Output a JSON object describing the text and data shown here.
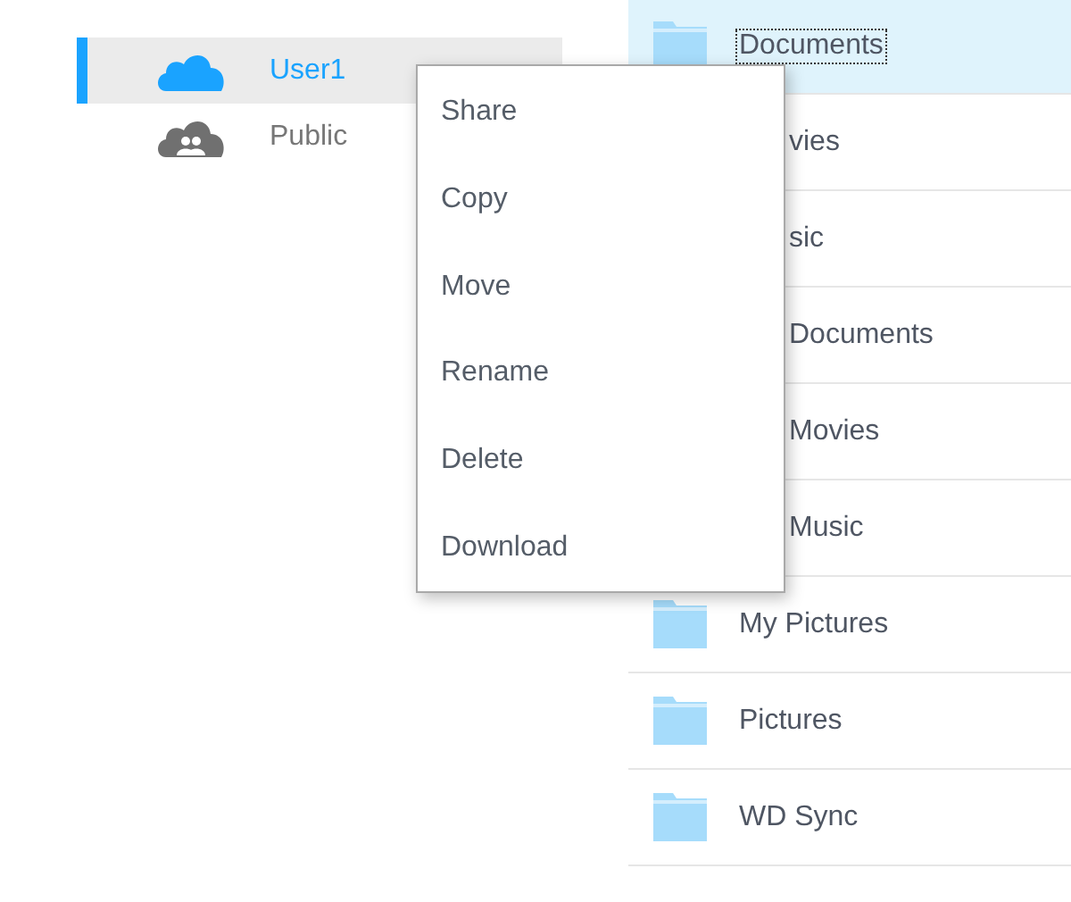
{
  "sidebar": {
    "items": [
      {
        "label": "User1",
        "kind": "private",
        "selected": true
      },
      {
        "label": "Public",
        "kind": "shared",
        "selected": false
      }
    ]
  },
  "files": [
    {
      "name": "Documents",
      "selected": true,
      "covered": false
    },
    {
      "name": "vies",
      "selected": false,
      "covered": true
    },
    {
      "name": "sic",
      "selected": false,
      "covered": true
    },
    {
      "name": "Documents",
      "selected": false,
      "covered": true
    },
    {
      "name": "Movies",
      "selected": false,
      "covered": true
    },
    {
      "name": "Music",
      "selected": false,
      "covered": true
    },
    {
      "name": "My Pictures",
      "selected": false,
      "covered": false
    },
    {
      "name": "Pictures",
      "selected": false,
      "covered": false
    },
    {
      "name": "WD Sync",
      "selected": false,
      "covered": false
    }
  ],
  "context_menu": {
    "items": [
      "Share",
      "Copy",
      "Move",
      "Rename",
      "Delete",
      "Download"
    ]
  }
}
